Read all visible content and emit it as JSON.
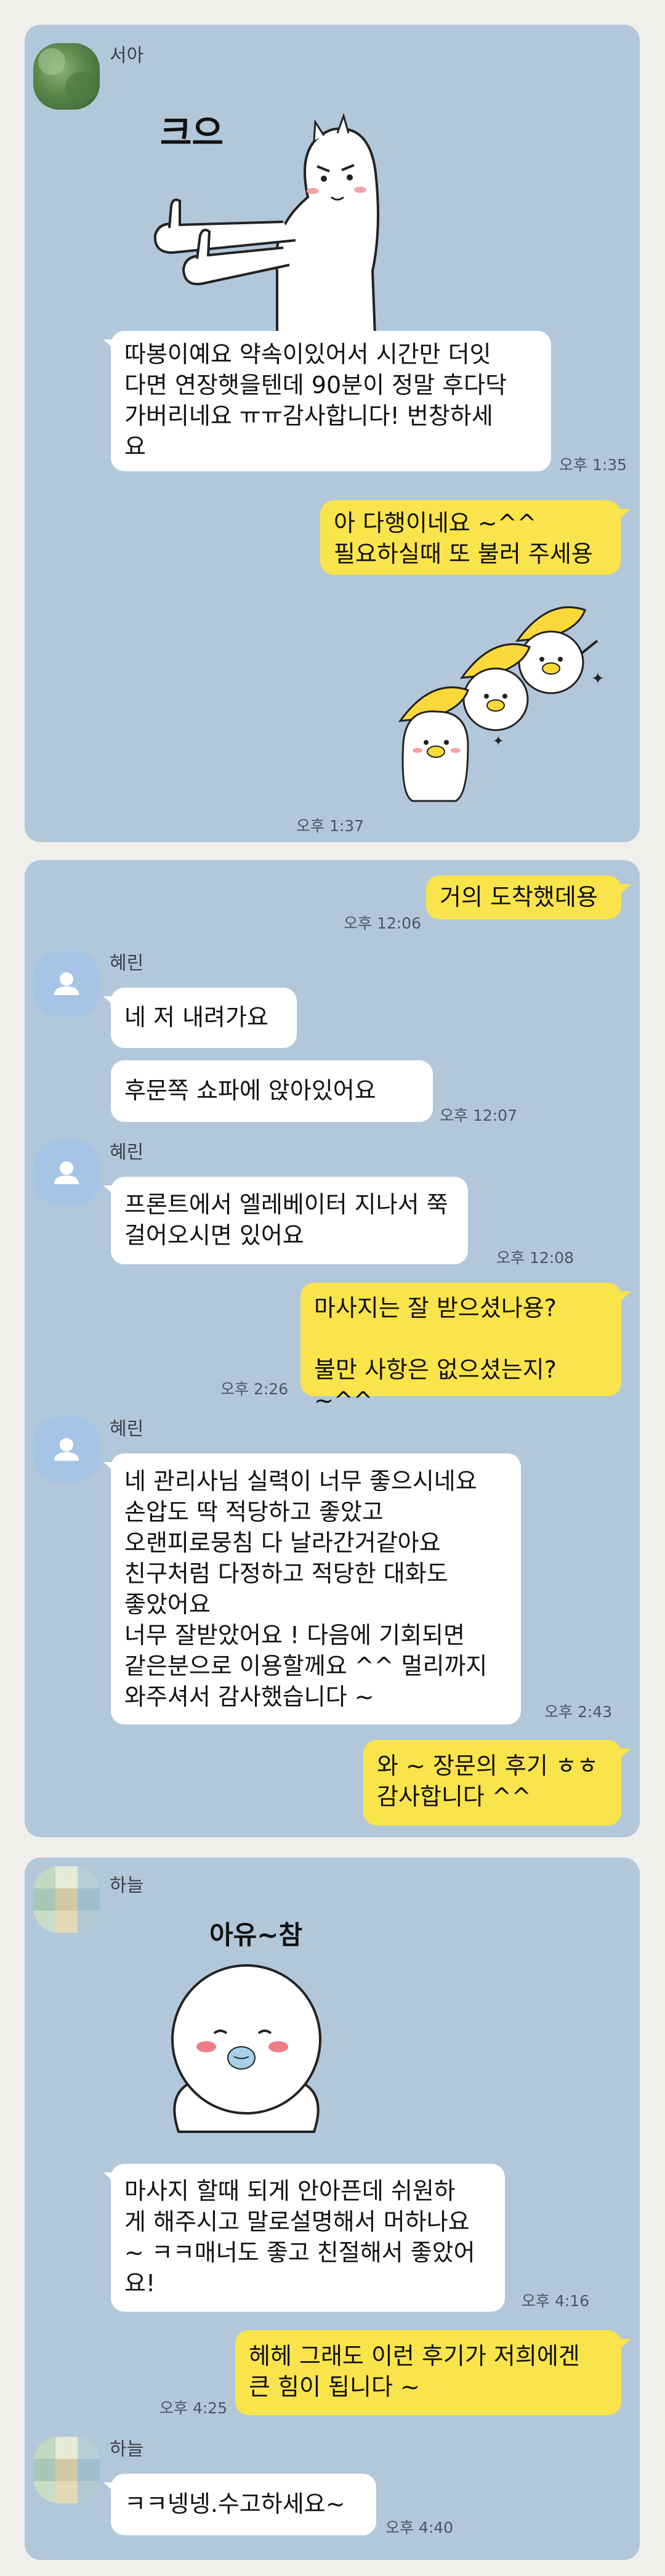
{
  "screen1": {
    "sender": "서아",
    "sticker_text": "크으",
    "msg1": "따봉이예요 약속이있어서 시간만 더잇\n다면 연장햇을텐데 90분이 정말 후다닥\n가버리네요 ㅠㅠ감사합니다! 번창하세\n요",
    "time1": "오후 1:35",
    "reply1": "아 다행이네요 ~^^\n필요하실때 또 불러 주세용",
    "time2": "오후 1:37"
  },
  "screen2": {
    "out1": "거의 도착했데용",
    "out1_time": "오후 12:06",
    "sender": "혜린",
    "in1": "네 저 내려가요",
    "in2": "후문쪽 쇼파에 앉아있어요",
    "in2_time": "오후 12:07",
    "in3": "프론트에서 엘레베이터 지나서 쭉\n걸어오시면 있어요",
    "in3_time": "오후 12:08",
    "out2": "마사지는 잘 받으셨나용?\n\n불만 사항은 없으셨는지? ~^^",
    "out2_time": "오후 2:26",
    "in4": "네 관리사님 실력이 너무 좋으시네요\n손압도 딱 적당하고 좋았고\n오랜피로뭉침 다 날라간거같아요\n친구처럼 다정하고 적당한 대화도\n좋았어요\n너무 잘받았어요 ! 다음에 기회되면\n같은분으로 이용할께요 ^^ 멀리까지\n와주셔서 감사했습니다 ~",
    "in4_time": "오후 2:43",
    "out3": "와 ~ 장문의 후기 ㅎㅎ\n감사합니다 ^^"
  },
  "screen3": {
    "sender": "하늘",
    "sticker_text": "아유~참",
    "in1": "마사지 할때 되게 안아픈데 쉬원하\n게 해주시고 말로설명해서 머하나요\n~ ㅋㅋ매너도 좋고 친절해서 좋았어\n요!",
    "in1_time": "오후 4:16",
    "out1": "헤헤 그래도 이런 후기가 저희에겐\n큰 힘이 됩니다 ~",
    "out1_time": "오후 4:25",
    "sender2": "하늘",
    "in2": "ㅋㅋ넹넹.수고하세요~",
    "in2_time": "오후 4:40"
  },
  "colors": {
    "chat_bg": "#b2c7da",
    "incoming": "#ffffff",
    "outgoing": "#fae44b",
    "page_bg": "#f1efec"
  }
}
